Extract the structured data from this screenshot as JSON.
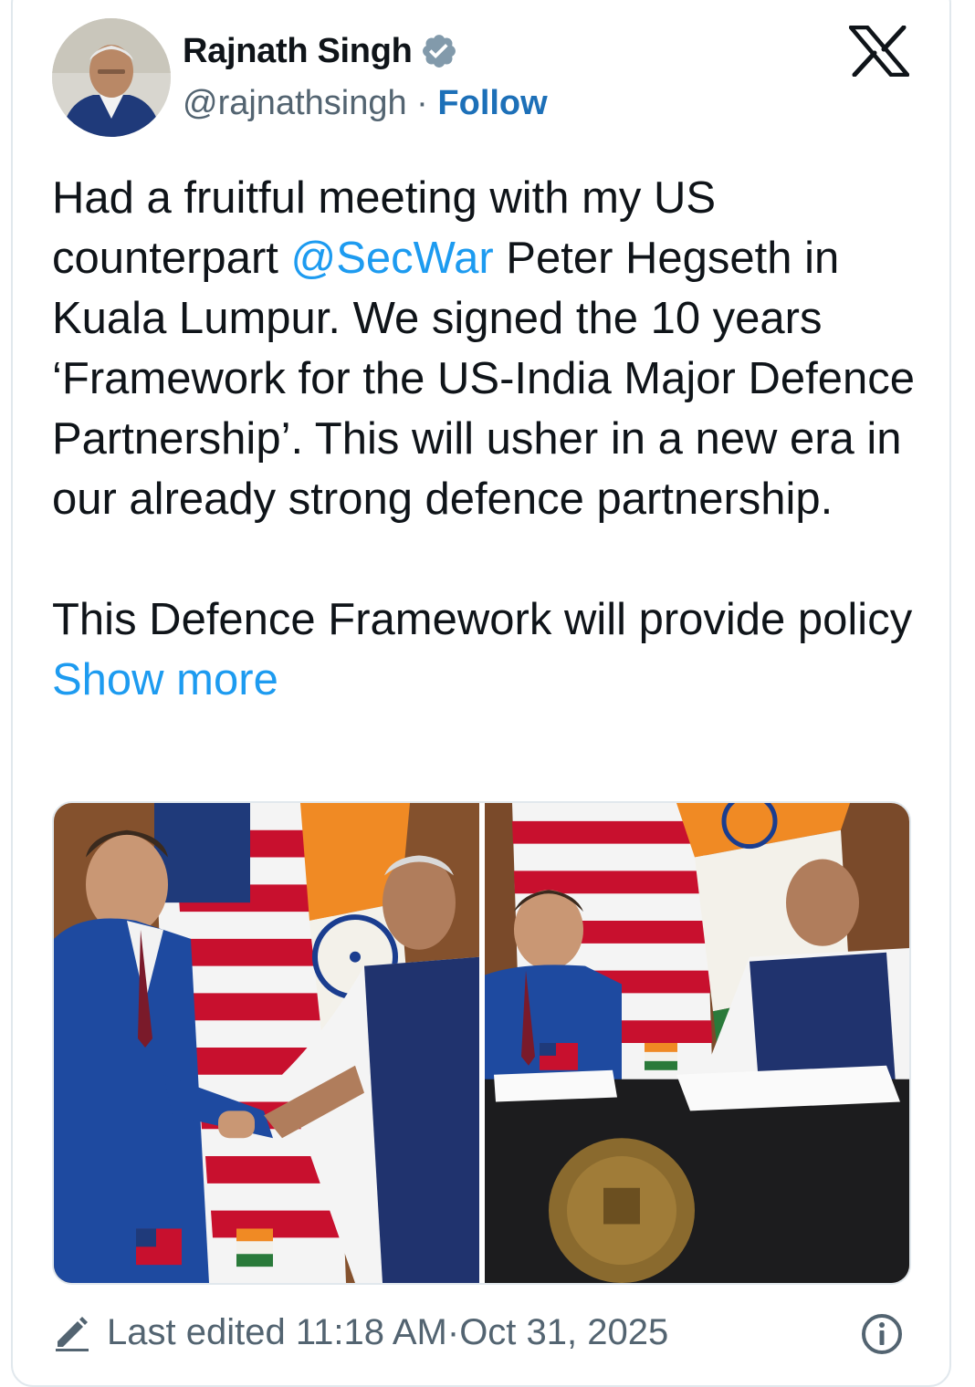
{
  "author": {
    "name": "Rajnath Singh",
    "handle": "@rajnathsingh",
    "separator": " · ",
    "follow_label": "Follow"
  },
  "tweet": {
    "text_part1": "Had a fruitful meeting with my US counterpart ",
    "mention": "@SecWar",
    "text_part2": " Peter Hegseth in Kuala Lumpur. We signed the 10 years ‘Framework for the US-India Major Defence Partnership’. This will usher in a new era in our already strong defence partnership.",
    "text_para2": "This Defence Framework will provide policy ",
    "show_more_label": "Show more"
  },
  "footer": {
    "edited_label": "Last edited 11:18 AM",
    "separator": " · ",
    "date": "Oct 31, 2025"
  },
  "icons": {
    "verified": "verified-badge-icon",
    "x_logo": "x-logo-icon",
    "pencil": "pencil-icon",
    "info": "info-icon"
  },
  "colors": {
    "link": "#1d9bf0",
    "follow": "#1d70b8",
    "muted": "#536471",
    "text": "#0f1419"
  }
}
